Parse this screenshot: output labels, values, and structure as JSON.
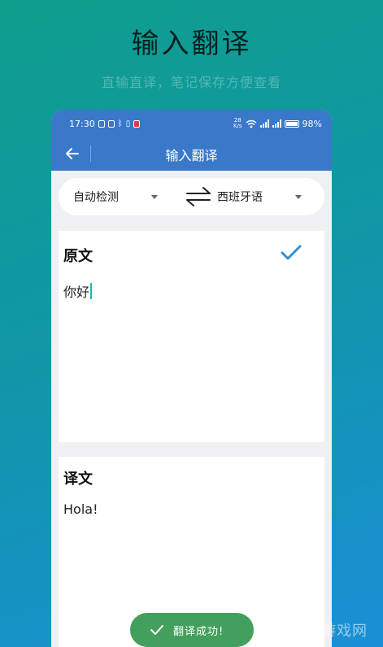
{
  "promo": {
    "title": "输入翻译",
    "subtitle": "直输直译，笔记保存方便查看"
  },
  "status_bar": {
    "time": "17:30",
    "speed_value": "28",
    "speed_unit": "K/s",
    "battery": "98%"
  },
  "app_bar": {
    "title": "输入翻译",
    "back_icon": "back-arrow-icon"
  },
  "language_bar": {
    "source_language": "自动检测",
    "target_language": "西班牙语",
    "swap_icon": "swap-arrows-icon"
  },
  "source_card": {
    "label": "原文",
    "text": "你好",
    "confirm_icon": "checkmark-icon"
  },
  "target_card": {
    "label": "译文",
    "text": "Hola!"
  },
  "toast": {
    "icon": "checkmark-icon",
    "message": "翻译成功!"
  },
  "watermark": "周四游戏网",
  "colors": {
    "app_bar": "#3a78c9",
    "accent_check": "#2e8fd6",
    "toast_bg": "#43a05c"
  }
}
